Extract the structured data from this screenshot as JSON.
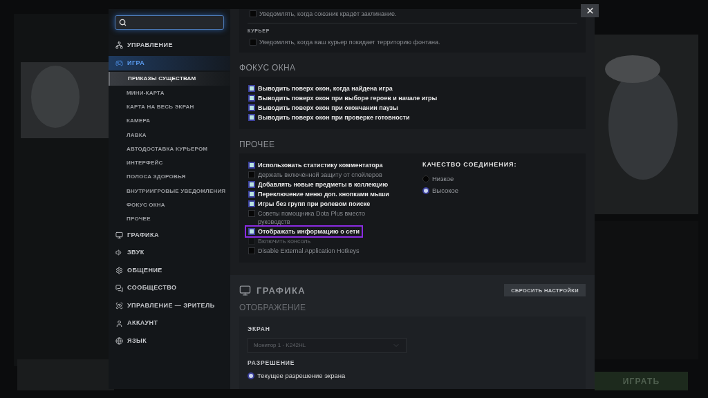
{
  "background": {
    "play_button": "ИГРАТЬ"
  },
  "sidebar": {
    "categories": [
      {
        "label": "УПРАВЛЕНИЕ",
        "selected": false
      },
      {
        "label": "ИГРА",
        "selected": true,
        "children": [
          {
            "label": "ПРИКАЗЫ СУЩЕСТВАМ",
            "selected": true
          },
          {
            "label": "МИНИ-КАРТА",
            "selected": false
          },
          {
            "label": "КАРТА НА ВЕСЬ ЭКРАН",
            "selected": false
          },
          {
            "label": "КАМЕРА",
            "selected": false
          },
          {
            "label": "ЛАВКА",
            "selected": false
          },
          {
            "label": "АВТОДОСТАВКА КУРЬЕРОМ",
            "selected": false
          },
          {
            "label": "ИНТЕРФЕЙС",
            "selected": false
          },
          {
            "label": "ПОЛОСА ЗДОРОВЬЯ",
            "selected": false
          },
          {
            "label": "ВНУТРИИГРОВЫЕ УВЕДОМЛЕНИЯ",
            "selected": false
          },
          {
            "label": "ФОКУС ОКНА",
            "selected": false
          },
          {
            "label": "ПРОЧЕЕ",
            "selected": false
          }
        ]
      },
      {
        "label": "ГРАФИКА",
        "selected": false
      },
      {
        "label": "ЗВУК",
        "selected": false
      },
      {
        "label": "ОБЩЕНИЕ",
        "selected": false
      },
      {
        "label": "СООБЩЕСТВО",
        "selected": false
      },
      {
        "label": "УПРАВЛЕНИЕ — ЗРИТЕЛЬ",
        "selected": false
      },
      {
        "label": "АККАУНТ",
        "selected": false
      },
      {
        "label": "ЯЗЫК",
        "selected": false
      }
    ]
  },
  "notifications_card": {
    "groups": [
      {
        "items": [
          {
            "label": "Уведомлять, когда союзник крадёт заклинание.",
            "checked": false,
            "disabled": false,
            "highlighted": false
          }
        ]
      },
      {
        "title": "КУРЬЕР",
        "items": [
          {
            "label": "Уведомлять, когда ваш курьер покидает территорию фонтана.",
            "checked": false,
            "disabled": false,
            "highlighted": false
          }
        ]
      }
    ]
  },
  "window_focus": {
    "heading": "ФОКУС ОКНА",
    "items": [
      {
        "label": "Выводить поверх окон, когда найдена игра",
        "checked": true,
        "disabled": false,
        "highlighted": false
      },
      {
        "label": "Выводить поверх окон при выборе героев и начале игры",
        "checked": true,
        "disabled": false,
        "highlighted": false
      },
      {
        "label": "Выводить поверх окон при окончании паузы",
        "checked": true,
        "disabled": false,
        "highlighted": false
      },
      {
        "label": "Выводить поверх окон при проверке готовности",
        "checked": true,
        "disabled": false,
        "highlighted": false
      }
    ]
  },
  "other": {
    "heading": "ПРОЧЕЕ",
    "items": [
      {
        "label": "Использовать статистику комментатора",
        "checked": true,
        "disabled": false,
        "highlighted": false
      },
      {
        "label": "Держать включённой защиту от спойлеров",
        "checked": false,
        "disabled": false,
        "highlighted": false
      },
      {
        "label": "Добавлять новые предметы в коллекцию",
        "checked": true,
        "disabled": false,
        "highlighted": false
      },
      {
        "label": "Переключение меню доп. кнопками мыши",
        "checked": true,
        "disabled": false,
        "highlighted": false
      },
      {
        "label": "Игры без групп при ролевом поиске",
        "checked": true,
        "disabled": false,
        "highlighted": false
      },
      {
        "label": "Советы помощника Dota Plus вместо руководств",
        "checked": false,
        "disabled": false,
        "highlighted": false
      },
      {
        "label": "Отображать информацию о сети",
        "checked": true,
        "disabled": false,
        "highlighted": true
      },
      {
        "label": "Включить консоль",
        "checked": false,
        "disabled": true,
        "highlighted": false
      },
      {
        "label": "Disable External Application Hotkeys",
        "checked": false,
        "disabled": false,
        "highlighted": false
      }
    ],
    "connection_quality": {
      "title": "КАЧЕСТВО СОЕДИНЕНИЯ:",
      "options": [
        {
          "label": "Низкое",
          "selected": false
        },
        {
          "label": "Высокое",
          "selected": true
        }
      ]
    }
  },
  "graphics": {
    "title": "ГРАФИКА",
    "reset_button": "СБРОСИТЬ НАСТРОЙКИ",
    "subheading": "ОТОБРАЖЕНИЕ",
    "screen": {
      "label": "ЭКРАН",
      "value": "Монитор 1 - K242HL",
      "disabled": true
    },
    "resolution": {
      "label": "РАЗРЕШЕНИЕ",
      "options": [
        {
          "label": "Текущее разрешение экрана",
          "selected": true
        }
      ]
    }
  }
}
